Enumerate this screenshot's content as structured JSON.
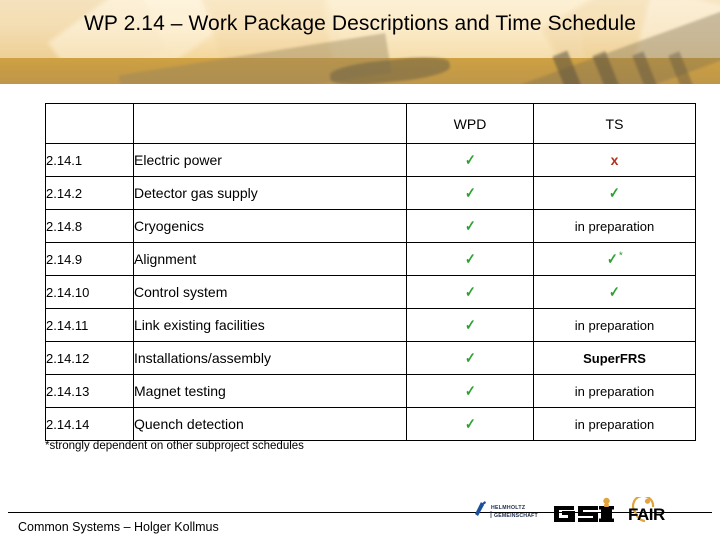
{
  "slide": {
    "title": "WP 2.14 – Work Package Descriptions and Time Schedule",
    "footnote": "*strongly dependent on other subproject schedules",
    "footer_text": "Common Systems – Holger Kollmus"
  },
  "table": {
    "headers": {
      "id": "",
      "name": "",
      "wpd": "WPD",
      "ts": "TS"
    },
    "rows": [
      {
        "id": "2.14.1",
        "name": "Electric power",
        "wpd": "check",
        "ts": "x",
        "ts_kind": "x"
      },
      {
        "id": "2.14.2",
        "name": "Detector gas supply",
        "wpd": "check",
        "ts": "check",
        "ts_kind": "check"
      },
      {
        "id": "2.14.8",
        "name": "Cryogenics",
        "wpd": "check",
        "ts": "in preparation",
        "ts_kind": "text"
      },
      {
        "id": "2.14.9",
        "name": "Alignment",
        "wpd": "check",
        "ts": "check*",
        "ts_kind": "check-star"
      },
      {
        "id": "2.14.10",
        "name": "Control system",
        "wpd": "check",
        "ts": "check",
        "ts_kind": "check"
      },
      {
        "id": "2.14.11",
        "name": "Link existing facilities",
        "wpd": "check",
        "ts": "in preparation",
        "ts_kind": "text"
      },
      {
        "id": "2.14.12",
        "name": "Installations/assembly",
        "wpd": "check",
        "ts": "SuperFRS",
        "ts_kind": "text-bold"
      },
      {
        "id": "2.14.13",
        "name": "Magnet testing",
        "wpd": "check",
        "ts": "in preparation",
        "ts_kind": "text"
      },
      {
        "id": "2.14.14",
        "name": "Quench detection",
        "wpd": "check",
        "ts": "in preparation",
        "ts_kind": "text"
      }
    ],
    "glyphs": {
      "check": "✓",
      "x": "x",
      "star": "*"
    }
  },
  "logos": [
    {
      "name": "helmholtz-logo",
      "line1": "HELMHOLTZ",
      "line2": "GEMEINSCHAFT"
    },
    {
      "name": "gsi-logo",
      "text": "GSI"
    },
    {
      "name": "fair-logo",
      "text": "FAIR"
    }
  ],
  "colors": {
    "check_green": "#2ba12f",
    "x_red": "#b3301f",
    "banner_light": "#fbe8c3",
    "banner_dark": "#c79c44",
    "logo_gold": "#e2a33c",
    "helmholtz_blue": "#1a4f9c"
  }
}
